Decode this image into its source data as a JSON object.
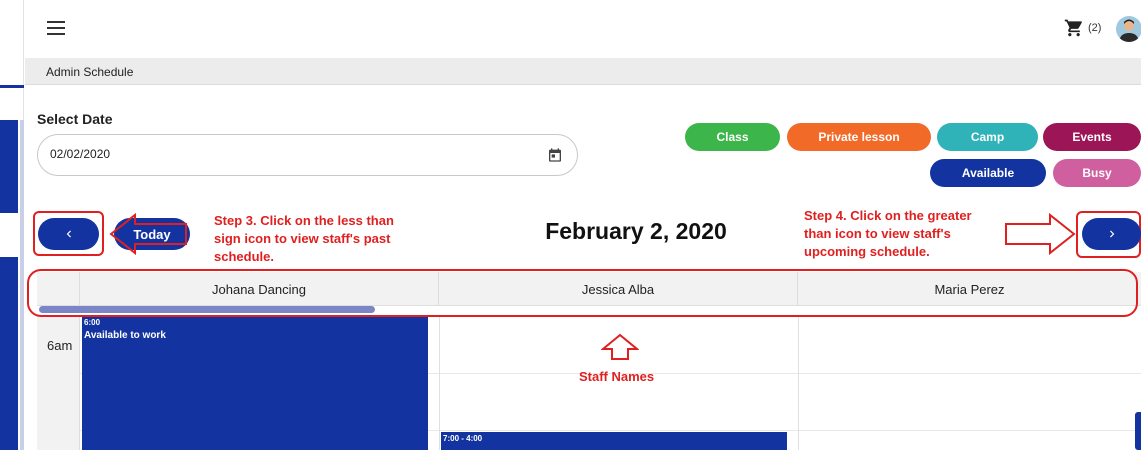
{
  "header": {
    "cart_count": "(2)",
    "breadcrumb": "Admin Schedule"
  },
  "date_picker": {
    "label": "Select Date",
    "value": "02/02/2020"
  },
  "legend": [
    {
      "label": "Class",
      "color": "#3cb54a"
    },
    {
      "label": "Private lesson",
      "color": "#f26a28"
    },
    {
      "label": "Camp",
      "color": "#2fb3b8"
    },
    {
      "label": "Events",
      "color": "#9c1557"
    },
    {
      "label": "Available",
      "color": "#1334a0"
    },
    {
      "label": "Busy",
      "color": "#d05fa0"
    }
  ],
  "nav": {
    "today_label": "Today",
    "current_date": "February 2, 2020"
  },
  "annotations": {
    "step3": "Step 3. Click on the less than sign icon to view staff's past schedule.",
    "step4": "Step 4. Click on the greater than icon to view staff's upcoming schedule.",
    "staff_names": "Staff Names"
  },
  "calendar": {
    "staff": [
      "Johana Dancing",
      "Jessica Alba",
      "Maria Perez"
    ],
    "time_label": "6am",
    "events": [
      {
        "time": "6:00",
        "title": "Available to work"
      },
      {
        "time": "7:00 - 4:00",
        "title": ""
      }
    ]
  },
  "colors": {
    "primary": "#1334a0",
    "annotation": "#e02020"
  }
}
